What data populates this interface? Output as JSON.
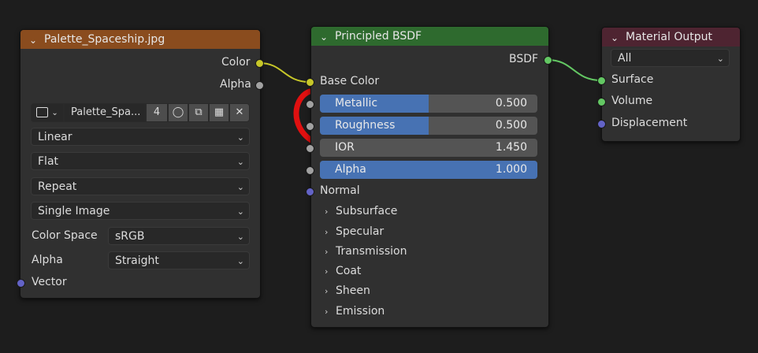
{
  "image_node": {
    "title": "Palette_Spaceship.jpg",
    "outputs": {
      "color": "Color",
      "alpha": "Alpha"
    },
    "image_name": "Palette_Spa...",
    "users_count": "4",
    "interpolation": "Linear",
    "projection": "Flat",
    "extension": "Repeat",
    "source": "Single Image",
    "color_space_label": "Color Space",
    "color_space": "sRGB",
    "alpha_label": "Alpha",
    "alpha_mode": "Straight",
    "vector_label": "Vector",
    "header_color": "#8a4c1e"
  },
  "bsdf_node": {
    "title": "Principled BSDF",
    "output": "BSDF",
    "base_color": "Base Color",
    "fields": [
      {
        "name": "Metallic",
        "value": "0.500",
        "fill": 0.5
      },
      {
        "name": "Roughness",
        "value": "0.500",
        "fill": 0.5
      },
      {
        "name": "IOR",
        "value": "1.450",
        "fill": 0
      },
      {
        "name": "Alpha",
        "value": "1.000",
        "fill": 1.0
      }
    ],
    "normal": "Normal",
    "panels": [
      "Subsurface",
      "Specular",
      "Transmission",
      "Coat",
      "Sheen",
      "Emission"
    ],
    "header_color": "#2e6a2e"
  },
  "output_node": {
    "title": "Material Output",
    "target": "All",
    "inputs": {
      "surface": "Surface",
      "volume": "Volume",
      "displacement": "Displacement"
    },
    "header_color": "#4e2431"
  },
  "colors": {
    "accent": "#4772b3",
    "annotation": "#e01010",
    "wire_color": "#c7c729",
    "wire_shader": "#63c763"
  }
}
